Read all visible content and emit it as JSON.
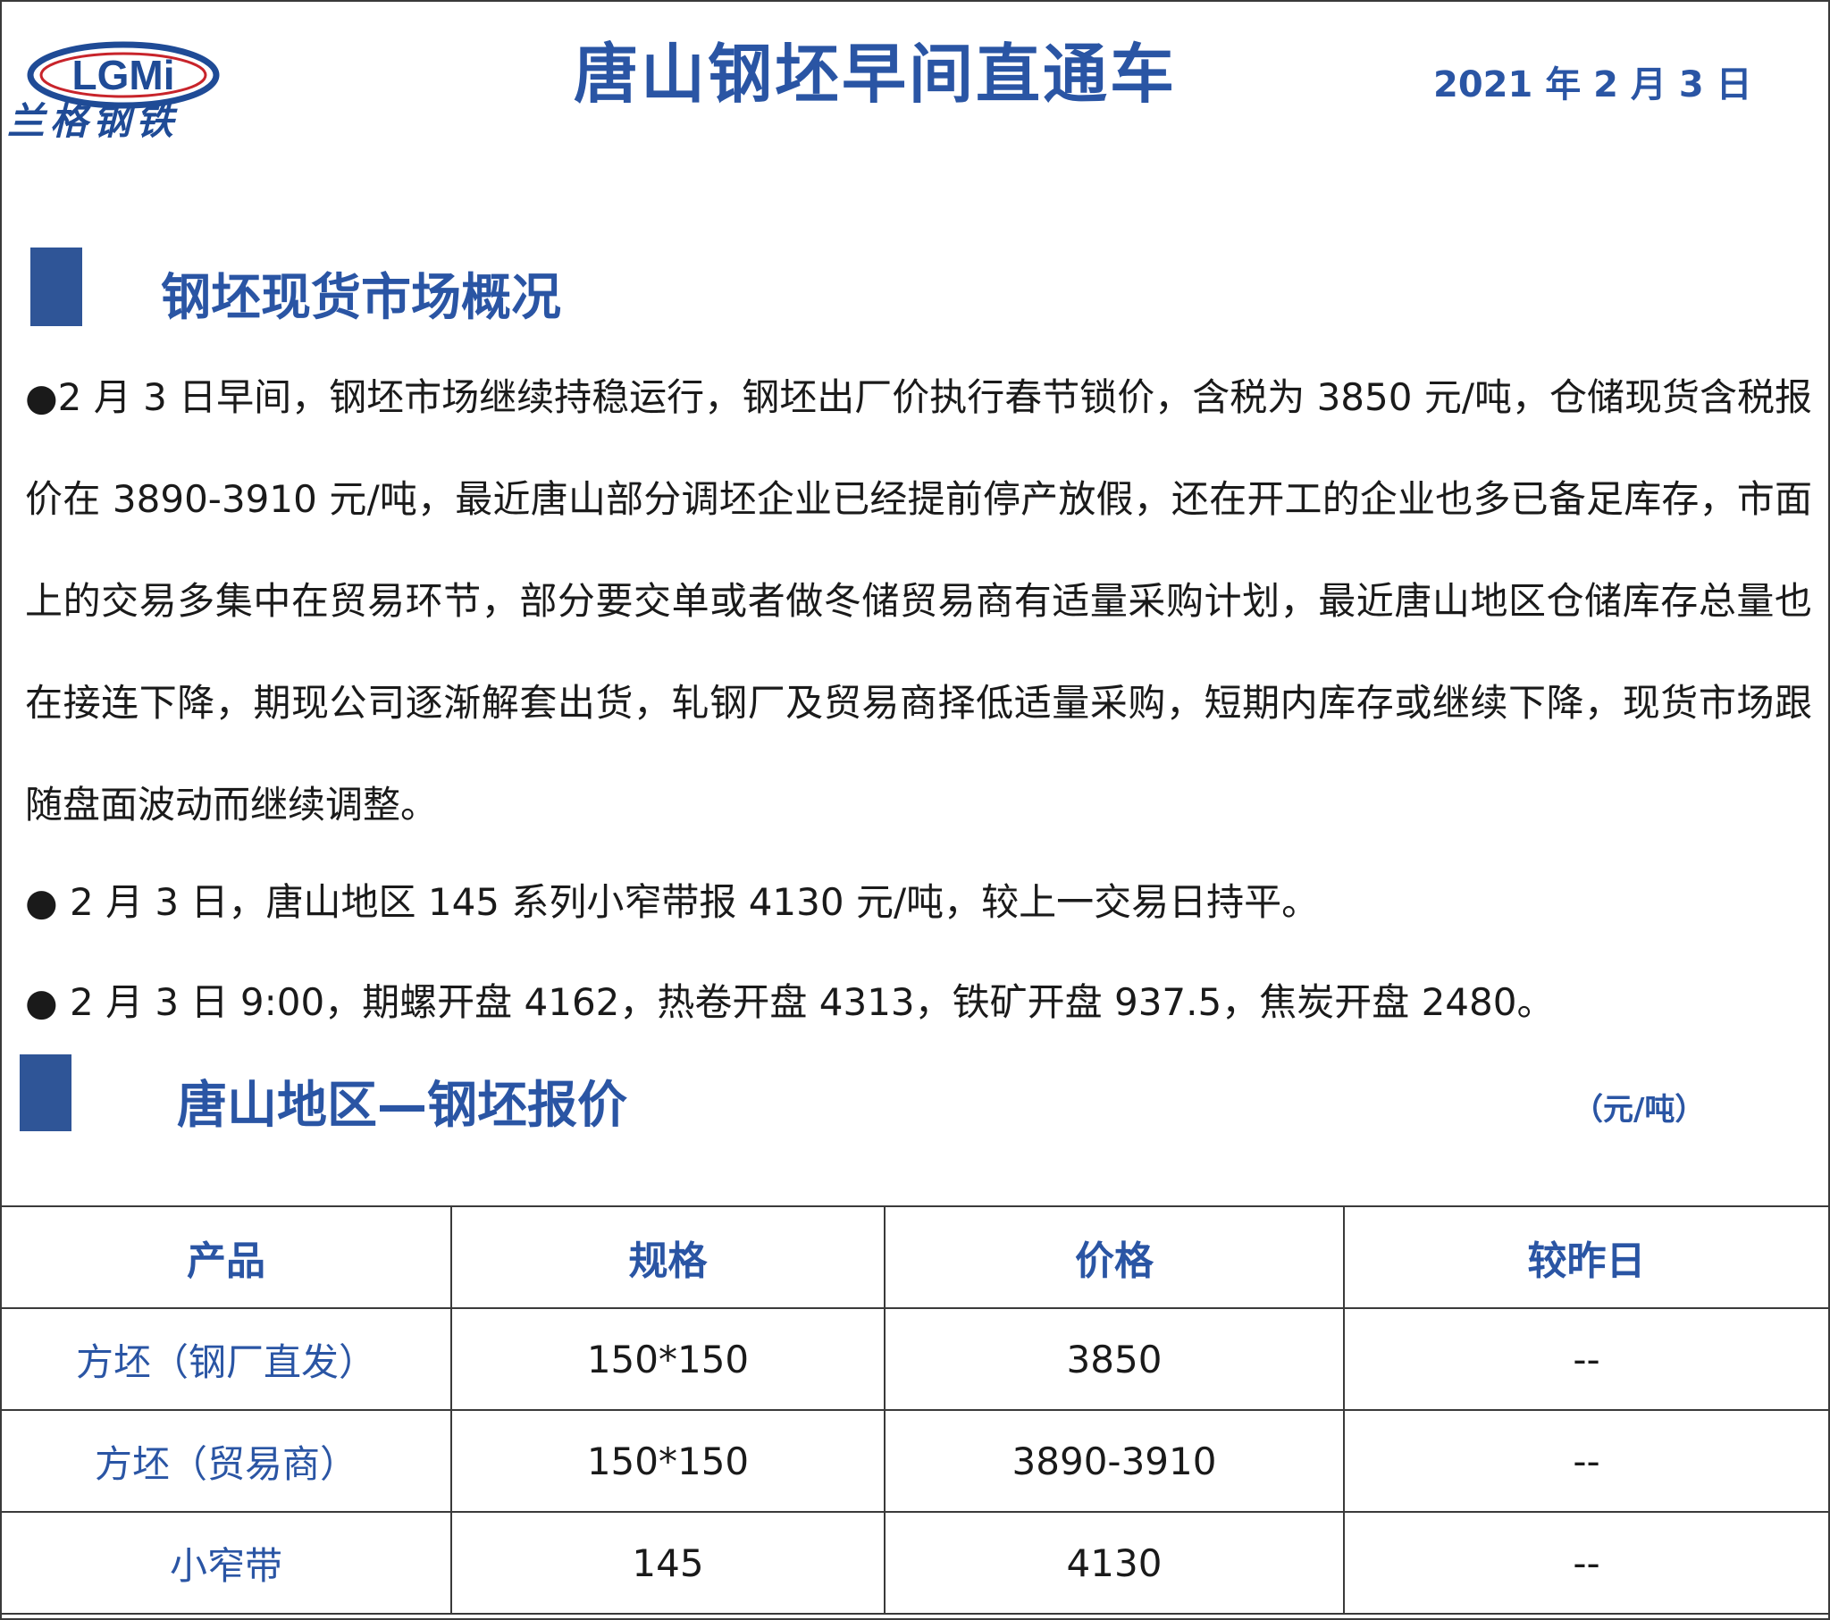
{
  "header": {
    "logo_mark": "LGMi",
    "logo_name": "兰格钢铁",
    "title": "唐山钢坯早间直通车",
    "date": "2021 年 2 月 3 日"
  },
  "section1": {
    "title": "钢坯现货市场概况",
    "paragraph": "●2 月 3 日早间，钢坯市场继续持稳运行，钢坯出厂价执行春节锁价，含税为 3850 元/吨，仓储现货含税报价在 3890-3910 元/吨，最近唐山部分调坯企业已经提前停产放假，还在开工的企业也多已备足库存，市面上的交易多集中在贸易环节，部分要交单或者做冬储贸易商有适量采购计划，最近唐山地区仓储库存总量也在接连下降，期现公司逐渐解套出货，轧钢厂及贸易商择低适量采购，短期内库存或继续下降，现货市场跟随盘面波动而继续调整。",
    "bullet1": "●  2 月 3 日，唐山地区 145 系列小窄带报 4130 元/吨，较上一交易日持平。",
    "bullet2": "●  2 月 3 日 9:00，期螺开盘 4162，热卷开盘 4313，铁矿开盘 937.5，焦炭开盘 2480。"
  },
  "section2": {
    "title": "唐山地区—钢坯报价",
    "unit": "（元/吨）"
  },
  "table": {
    "headers": [
      "产品",
      "规格",
      "价格",
      "较昨日"
    ],
    "rows": [
      [
        "方坯（钢厂直发）",
        "150*150",
        "3850",
        "--"
      ],
      [
        "方坯（贸易商）",
        "150*150",
        "3890-3910",
        "--"
      ],
      [
        "小窄带",
        "145",
        "4130",
        "--"
      ]
    ]
  },
  "colors": {
    "brand_blue": "#2a55a4",
    "bar_blue": "#2f5597"
  }
}
